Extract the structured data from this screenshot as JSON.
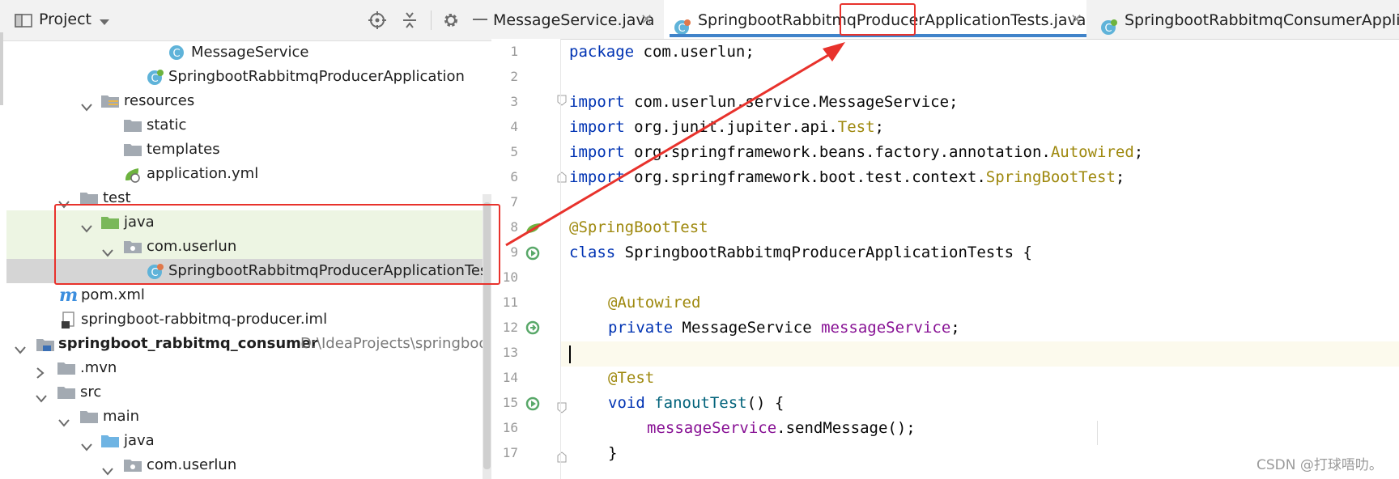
{
  "project_panel": {
    "title": "Project",
    "icons": [
      "project-folder-icon",
      "dropdown-icon",
      "locate-icon",
      "collapse-all-icon",
      "gear-icon",
      "minimize-icon"
    ],
    "tree": [
      {
        "label": "MessageService",
        "icon": "java-class-icon"
      },
      {
        "label": "SpringbootRabbitmqProducerApplication",
        "icon": "spring-boot-class-icon"
      },
      {
        "label": "resources",
        "icon": "resources-folder-icon",
        "expanded": true
      },
      {
        "label": "static",
        "icon": "folder-icon"
      },
      {
        "label": "templates",
        "icon": "folder-icon"
      },
      {
        "label": "application.yml",
        "icon": "spring-yml-icon"
      },
      {
        "label": "test",
        "icon": "folder-icon",
        "expanded": true
      },
      {
        "label": "java",
        "icon": "test-source-folder-icon",
        "expanded": true
      },
      {
        "label": "com.userlun",
        "icon": "package-icon",
        "expanded": true
      },
      {
        "label": "SpringbootRabbitmqProducerApplicationTests",
        "icon": "spring-test-class-icon",
        "selected": true
      },
      {
        "label": "pom.xml",
        "icon": "maven-icon"
      },
      {
        "label": "springboot-rabbitmq-producer.iml",
        "icon": "iml-icon"
      },
      {
        "label": "springboot_rabbitmq_consumer",
        "path": "D:\\IdeaProjects\\springboot_",
        "icon": "module-folder-icon",
        "expanded": true
      },
      {
        "label": ".mvn",
        "icon": "folder-icon",
        "expanded": false
      },
      {
        "label": "src",
        "icon": "folder-icon",
        "expanded": true
      },
      {
        "label": "main",
        "icon": "folder-icon",
        "expanded": true
      },
      {
        "label": "java",
        "icon": "source-folder-icon",
        "expanded": true
      },
      {
        "label": "com.userlun",
        "icon": "package-icon",
        "expanded": true
      }
    ]
  },
  "editor": {
    "tabs": [
      {
        "label": "MessageService.java",
        "active": false
      },
      {
        "label": "SpringbootRabbitmqProducerApplicationTests.java",
        "active": true
      },
      {
        "label": "SpringbootRabbitmqConsumerApplicati",
        "active": false
      }
    ],
    "line_numbers": [
      "1",
      "2",
      "3",
      "4",
      "5",
      "6",
      "7",
      "8",
      "9",
      "10",
      "11",
      "12",
      "13",
      "14",
      "15",
      "16",
      "17"
    ],
    "code": {
      "l1_kw": "package",
      "l1_rest": " com.userlun;",
      "l3_kw": "import",
      "l3_rest": " com.userlun.service.MessageService;",
      "l4_kw": "import",
      "l4_rest": " org.junit.jupiter.api.",
      "l4_cls": "Test",
      "l4_end": ";",
      "l5_kw": "import",
      "l5_rest": " org.springframework.beans.factory.annotation.",
      "l5_cls": "Autowired",
      "l5_end": ";",
      "l6_kw": "import",
      "l6_rest": " org.springframework.boot.test.context.",
      "l6_cls": "SpringBootTest",
      "l6_end": ";",
      "l8_ann": "@SpringBootTest",
      "l9_kw": "class",
      "l9_rest": " SpringbootRabbitmqProducerApplicationTests {",
      "l11_ann": "@Autowired",
      "l12_kw": "private",
      "l12_rest": " MessageService ",
      "l12_fld": "messageService",
      "l12_end": ";",
      "l14_ann": "@Test",
      "l15_kw": "void",
      "l15_mth": "fanoutTest",
      "l15_end": "() {",
      "l16_fld": "messageService",
      "l16_end": ".sendMessage();",
      "l17": "}"
    }
  },
  "annotation": {
    "color": "#e8322c"
  },
  "watermark": "CSDN @打球唔叻。"
}
